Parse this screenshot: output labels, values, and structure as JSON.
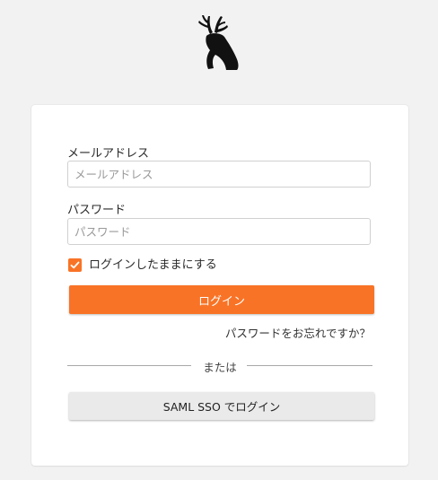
{
  "logo": {
    "icon": "deer-logo-icon"
  },
  "login_form": {
    "email": {
      "label": "メールアドレス",
      "placeholder": "メールアドレス",
      "value": ""
    },
    "password": {
      "label": "パスワード",
      "placeholder": "パスワード",
      "value": ""
    },
    "remember": {
      "label": "ログインしたままにする",
      "checked": true
    },
    "submit_label": "ログイン",
    "forgot_label": "パスワードをお忘れですか？",
    "divider_label": "または",
    "saml_label": "SAML SSO でログイン"
  },
  "colors": {
    "accent": "#f97326",
    "background": "#f2f2f2",
    "card": "#ffffff",
    "secondary_button": "#eaeaea"
  }
}
